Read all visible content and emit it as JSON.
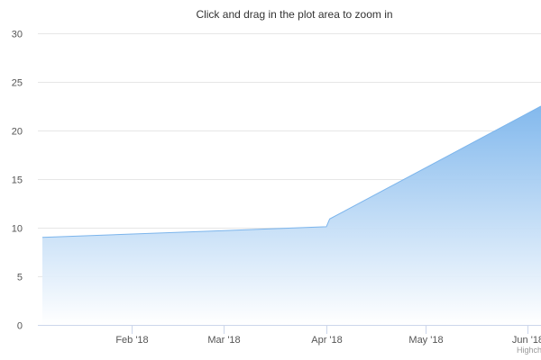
{
  "chart_data": {
    "type": "area",
    "subtitle": "Click and drag in the plot area to zoom in",
    "credits": "Highcharts.com",
    "ylim": [
      0,
      30
    ],
    "y_ticks": [
      0,
      5,
      10,
      15,
      20,
      25,
      30
    ],
    "x_range": [
      "2018-01-05",
      "2018-06-05"
    ],
    "x_ticks": [
      {
        "date": "2018-02-01",
        "label": "Feb '18"
      },
      {
        "date": "2018-03-01",
        "label": "Mar '18"
      },
      {
        "date": "2018-04-01",
        "label": "Apr '18"
      },
      {
        "date": "2018-05-01",
        "label": "May '18"
      },
      {
        "date": "2018-06-01",
        "label": "Jun '18"
      }
    ],
    "series": [
      {
        "points": [
          {
            "x": "2018-01-05",
            "y": 9.0
          },
          {
            "x": "2018-04-01",
            "y": 10.1
          },
          {
            "x": "2018-04-02",
            "y": 10.9
          },
          {
            "x": "2018-06-05",
            "y": 22.5
          }
        ]
      }
    ],
    "grid": true,
    "legend": "none",
    "colors": {
      "line": "#7cb5ec",
      "fill_top": "#7cb5ec",
      "fill_bottom": "#ffffff",
      "grid": "#e6e6e6",
      "axis": "#ccd6eb"
    }
  }
}
